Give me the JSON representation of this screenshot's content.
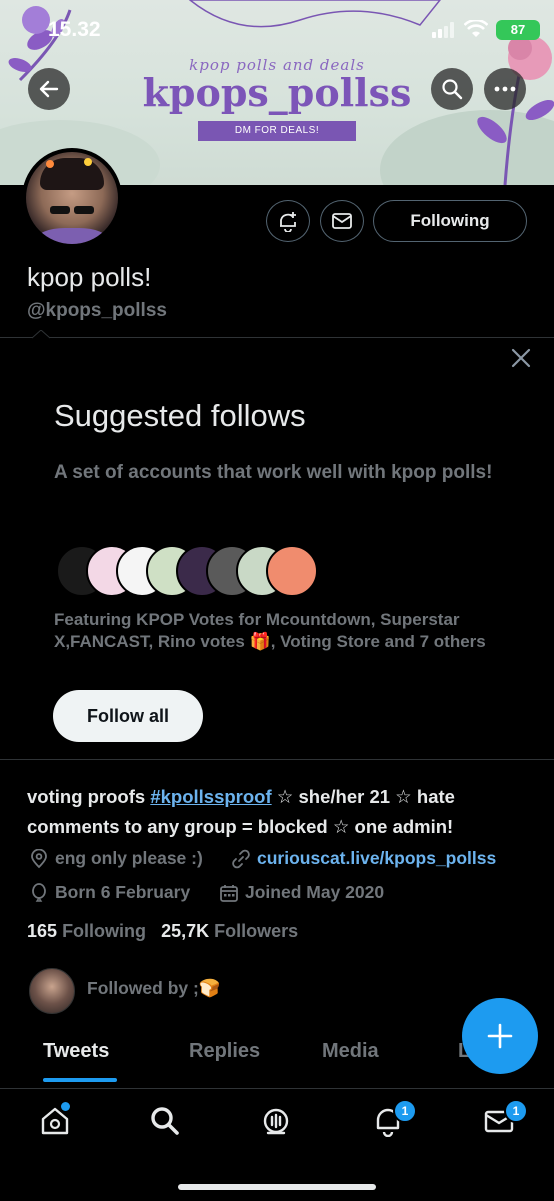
{
  "status_bar": {
    "time": "15.32",
    "battery": "87"
  },
  "banner": {
    "subtitle": "kpop polls and deals",
    "title": "kpops_pollss",
    "dm_label": "DM FOR DEALS!"
  },
  "header": {
    "following_label": "Following"
  },
  "profile": {
    "display_name": "kpop polls!",
    "handle": "@kpops_pollss",
    "bio_before": "voting proofs ",
    "bio_hashtag": "#kpollssproof",
    "bio_after": " ☆ she/her 21 ☆ hate comments to any group = blocked ☆ one admin!",
    "location": "eng only please :)",
    "link": "curiouscat.live/kpops_pollss",
    "birthday": "Born 6 February",
    "joined": "Joined May 2020",
    "following_count": "165",
    "following_label": "Following",
    "followers_count": "25,7K",
    "followers_label": "Followers",
    "followed_by": "Followed by ;🍞"
  },
  "suggested": {
    "title": "Suggested follows",
    "description": "A set of accounts that work well with kpop polls!",
    "featuring": "Featuring KPOP Votes for Mcountdown, Superstar X,FANCAST, Rino votes 🎁, Voting Store and 7 others",
    "follow_all_label": "Follow all"
  },
  "tabs": [
    "Tweets",
    "Replies",
    "Media",
    "Likes"
  ],
  "badges": {
    "notifications": "1",
    "messages": "1"
  },
  "colors": {
    "accent": "#1d9bf0",
    "banner_purple": "#7c55b8",
    "link": "#6cb3ee"
  }
}
